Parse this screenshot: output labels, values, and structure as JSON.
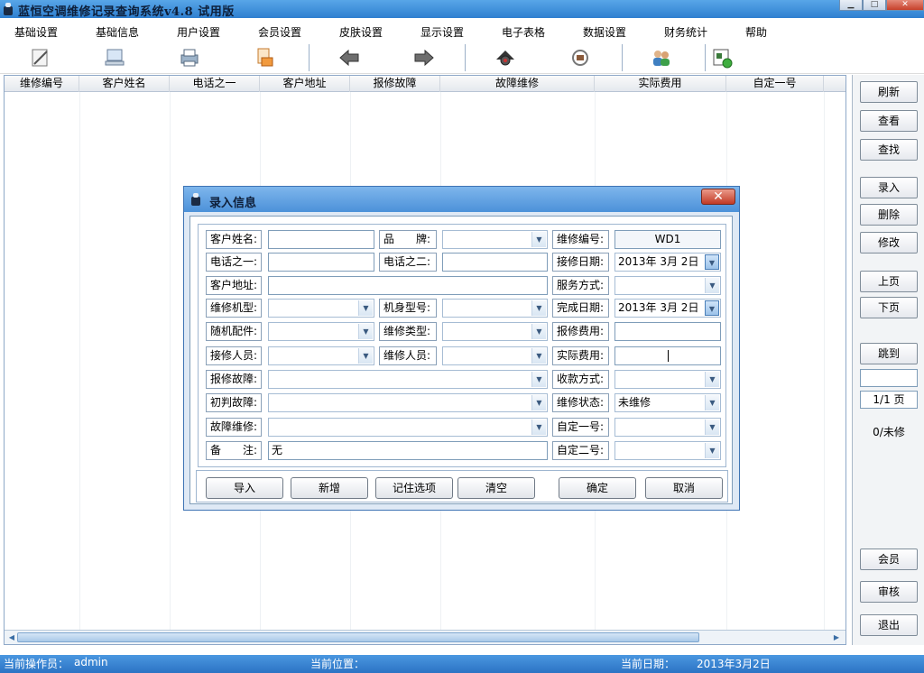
{
  "window": {
    "title": "蓝恒空调维修记录查询系统v4.8 试用版",
    "minimize_glyph": "▁",
    "maximize_glyph": "□",
    "close_glyph": "✕"
  },
  "menu": [
    "基础设置",
    "基础信息",
    "用户设置",
    "会员设置",
    "皮肤设置",
    "显示设置",
    "电子表格",
    "数据设置",
    "财务统计",
    "帮助"
  ],
  "toolbar": {
    "icons": [
      "edit-record-icon",
      "computer-icon",
      "printer-icon",
      "export-icon",
      "back-arrow-icon",
      "forward-arrow-icon",
      "find-icon",
      "service-icon",
      "users-icon",
      "exit-icon"
    ]
  },
  "grid": {
    "columns": [
      "维修编号",
      "客户姓名",
      "电话之一",
      "客户地址",
      "报修故障",
      "故障维修",
      "实际费用",
      "自定一号"
    ],
    "rows": [],
    "scroll_left": "◀",
    "scroll_right": "▶"
  },
  "sidebar": {
    "refresh": "刷新",
    "view": "查看",
    "find": "查找",
    "add": "录入",
    "delete": "删除",
    "edit": "修改",
    "prev_page": "上页",
    "next_page": "下页",
    "jump": "跳到",
    "jump_value": "",
    "page_indicator": "1/1 页",
    "repair_count": "0/未修",
    "member": "会员",
    "audit": "审核",
    "exit": "退出"
  },
  "dialog": {
    "title": "录入信息",
    "close_glyph": "✕",
    "dropdown_glyph": "▼",
    "labels": {
      "customer_name": "客户姓名:",
      "brand": "品　　牌:",
      "repair_no": "维修编号:",
      "phone1": "电话之一:",
      "phone2": "电话之二:",
      "receive_date": "接修日期:",
      "address": "客户地址:",
      "service_mode": "服务方式:",
      "machine_type": "维修机型:",
      "body_model": "机身型号:",
      "finish_date": "完成日期:",
      "accessories": "随机配件:",
      "repair_type": "维修类型:",
      "quoted_fee": "报修费用:",
      "receiver": "接修人员:",
      "technician": "维修人员:",
      "actual_fee": "实际费用:",
      "reported_fault": "报修故障:",
      "payment_mode": "收款方式:",
      "initial_fault": "初判故障:",
      "repair_status": "维修状态:",
      "fault_repair": "故障维修:",
      "custom1": "自定一号:",
      "remark": "备　　注:",
      "custom2": "自定二号:"
    },
    "values": {
      "customer_name": "",
      "brand": "",
      "repair_no": "WD1",
      "phone1": "",
      "phone2": "",
      "receive_date": "2013年  3月  2日",
      "address": "",
      "service_mode": "",
      "machine_type": "",
      "body_model": "",
      "finish_date": "2013年  3月  2日",
      "accessories": "",
      "repair_type": "",
      "quoted_fee": "",
      "receiver": "",
      "technician": "",
      "actual_fee": "",
      "reported_fault": "",
      "payment_mode": "",
      "initial_fault": "",
      "repair_status": "未维修",
      "fault_repair": "",
      "custom1": "",
      "remark": "无",
      "custom2": ""
    },
    "buttons": {
      "import": "导入",
      "add_new": "新增",
      "remember": "记住选项",
      "clear": "清空",
      "ok": "确定",
      "cancel": "取消"
    }
  },
  "status": {
    "operator_label": "当前操作员：",
    "operator": "admin",
    "location_label": "当前位置：",
    "location": "",
    "date_label": "当前日期：",
    "date": "2013年3月2日"
  }
}
